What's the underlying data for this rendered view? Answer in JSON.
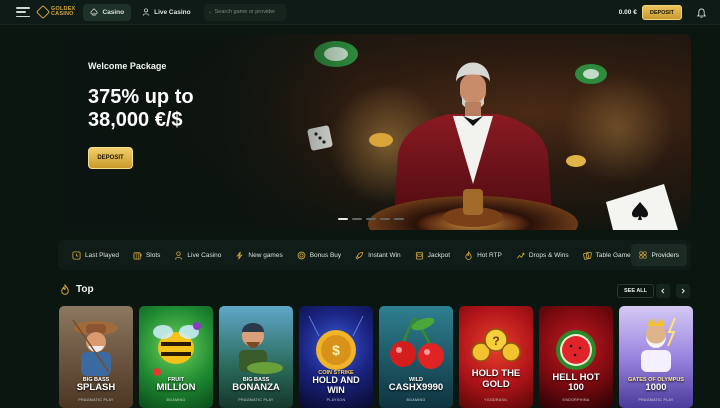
{
  "header": {
    "logo_text_line1": "GOLDEX",
    "logo_text_line2": "CASINO",
    "tab_casino": "Casino",
    "tab_live": "Live Casino",
    "search_placeholder": "Search game or provider",
    "balance": "0.00 €",
    "deposit_label": "DEPOSIT"
  },
  "hero": {
    "subtitle": "Welcome Package",
    "title_line1": "375% up to",
    "title_line2": "38,000 €/$",
    "button_label": "DEPOSIT",
    "slides": 5,
    "active_slide": 1
  },
  "categories": [
    {
      "label": "Last Played",
      "icon": "clock-icon"
    },
    {
      "label": "Slots",
      "icon": "slots-icon"
    },
    {
      "label": "Live Casino",
      "icon": "dealer-icon"
    },
    {
      "label": "New games",
      "icon": "bolt-icon"
    },
    {
      "label": "Bonus Buy",
      "icon": "coin-icon"
    },
    {
      "label": "Instant Win",
      "icon": "rocket-icon"
    },
    {
      "label": "Jackpot",
      "icon": "jackpot-icon"
    },
    {
      "label": "Hot RTP",
      "icon": "flame-icon"
    },
    {
      "label": "Drops & Wins",
      "icon": "drops-icon"
    },
    {
      "label": "Table Games",
      "icon": "cards-icon"
    }
  ],
  "providers_label": "Providers",
  "section": {
    "title": "Top",
    "see_all": "SEE ALL"
  },
  "games": [
    {
      "line1": "BIG BASS",
      "line2": "SPLASH",
      "provider": "PRAGMATIC PLAY",
      "bg1": "#7a6a5a",
      "bg2": "#3a2a1c"
    },
    {
      "line1": "FRUIT",
      "line2": "MILLION",
      "provider": "BGAMING",
      "bg1": "#3fb24a",
      "bg2": "#0e5a23"
    },
    {
      "line1": "BIG BASS",
      "line2": "BONANZA",
      "provider": "PRAGMATIC PLAY",
      "bg1": "#4d8fb0",
      "bg2": "#1e4a3a"
    },
    {
      "line1": "COIN STRIKE",
      "line2": "HOLD AND WIN",
      "provider": "PLAYSON",
      "bg1": "#2a3fa8",
      "bg2": "#0c0f3a"
    },
    {
      "line1": "WILD",
      "line2": "CASHX9990",
      "provider": "BGAMING",
      "bg1": "#2c6f7a",
      "bg2": "#0c2a35"
    },
    {
      "line1": "HOLD THE",
      "line2": "GOLD",
      "provider": "YGGDRASIL",
      "bg1": "#c1261f",
      "bg2": "#6a0c0c"
    },
    {
      "line1": "HELL HOT",
      "line2": "100",
      "provider": "ENDORPHINA",
      "bg1": "#a8141a",
      "bg2": "#3a0508"
    },
    {
      "line1": "GATES OF OLYMPUS",
      "line2": "1000",
      "provider": "PRAGMATIC PLAY",
      "bg1": "#b7a7ea",
      "bg2": "#5a4ab0"
    }
  ]
}
